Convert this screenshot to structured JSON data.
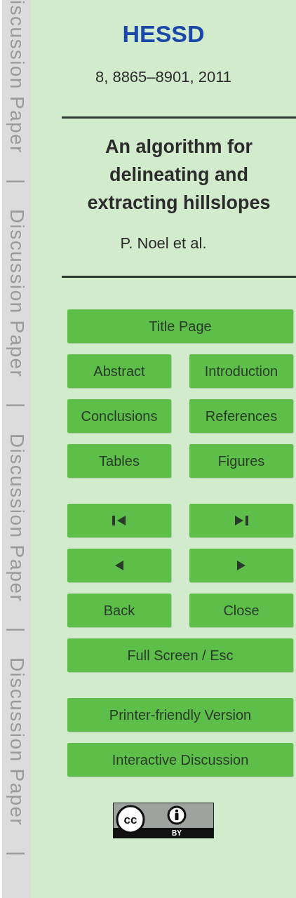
{
  "margin_strip": [
    {
      "kind": "label",
      "text": "iscussion Paper"
    },
    {
      "kind": "separator",
      "text": "|"
    },
    {
      "kind": "label",
      "text": "Discussion Paper"
    },
    {
      "kind": "separator",
      "text": "|"
    },
    {
      "kind": "label",
      "text": "Discussion Paper"
    },
    {
      "kind": "separator",
      "text": "|"
    },
    {
      "kind": "label",
      "text": "Discussion Paper"
    },
    {
      "kind": "separator",
      "text": "|"
    }
  ],
  "journal": "HESSD",
  "citation": "8, 8865–8901, 2011",
  "title": "An algorithm for delineating and extracting hillslopes",
  "authors": "P. Noel et al.",
  "button_groups": [
    [
      [
        {
          "kind": "text",
          "label": "Title Page"
        }
      ],
      [
        {
          "kind": "text",
          "label": "Abstract"
        },
        {
          "kind": "text",
          "label": "Introduction"
        }
      ],
      [
        {
          "kind": "text",
          "label": "Conclusions"
        },
        {
          "kind": "text",
          "label": "References"
        }
      ],
      [
        {
          "kind": "text",
          "label": "Tables"
        },
        {
          "kind": "text",
          "label": "Figures"
        }
      ]
    ],
    [
      [
        {
          "kind": "first"
        },
        {
          "kind": "last"
        }
      ],
      [
        {
          "kind": "previous"
        },
        {
          "kind": "next"
        }
      ],
      [
        {
          "kind": "text",
          "label": "Back"
        },
        {
          "kind": "text",
          "label": "Close"
        }
      ],
      [
        {
          "kind": "text",
          "label": "Full Screen / Esc"
        }
      ]
    ],
    [
      [
        {
          "kind": "text",
          "label": "Printer-friendly Version"
        }
      ],
      [
        {
          "kind": "text",
          "label": "Interactive Discussion"
        }
      ]
    ]
  ],
  "license_badge": {
    "mark": "cc",
    "label": "BY"
  }
}
